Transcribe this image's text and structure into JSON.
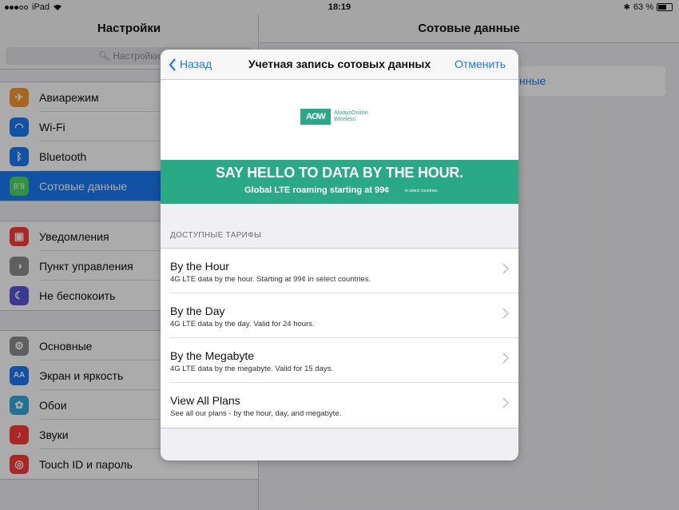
{
  "status_bar": {
    "carrier": "iPad",
    "time": "18:19",
    "battery": "63 %",
    "battery_level": 0.63
  },
  "left_pane": {
    "title": "Настройки",
    "search_placeholder": "Настройки",
    "groups": [
      [
        {
          "label": "Авиарежим",
          "icon": "airplane-icon",
          "color": "#f79a2c"
        },
        {
          "label": "Wi-Fi",
          "icon": "wifi-icon",
          "color": "#1a7bf5"
        },
        {
          "label": "Bluetooth",
          "icon": "bluetooth-icon",
          "color": "#1a7bf5"
        },
        {
          "label": "Сотовые данные",
          "icon": "antenna-icon",
          "color": "#4cd964",
          "selected": true
        }
      ],
      [
        {
          "label": "Уведомления",
          "icon": "notifications-icon",
          "color": "#fc3d39"
        },
        {
          "label": "Пункт управления",
          "icon": "control-center-icon",
          "color": "#8e8e93"
        },
        {
          "label": "Не беспокоить",
          "icon": "moon-icon",
          "color": "#5856d6"
        }
      ],
      [
        {
          "label": "Основные",
          "icon": "gear-icon",
          "color": "#8e8e93"
        },
        {
          "label": "Экран и яркость",
          "icon": "text-size-icon",
          "color": "#1a7bf5"
        },
        {
          "label": "Обои",
          "icon": "flower-icon",
          "color": "#34aadc"
        },
        {
          "label": "Звуки",
          "icon": "speaker-icon",
          "color": "#fc3d39"
        },
        {
          "label": "Touch ID и пароль",
          "icon": "fingerprint-icon",
          "color": "#fc3d39"
        }
      ]
    ]
  },
  "right_pane": {
    "title": "Сотовые данные",
    "cell_fragment": "нные"
  },
  "modal": {
    "back_label": "Назад",
    "title": "Учетная запись сотовых данных",
    "cancel_label": "Отменить",
    "logo_mark": "AOW",
    "logo_name_line1": "AlwaysOnline",
    "logo_name_line2": "Wireless",
    "banner_headline": "SAY HELLO TO DATA BY THE HOUR.",
    "banner_sub": "Global LTE roaming starting at 99¢",
    "banner_note": "in select countries.",
    "section_header": "ДОСТУПНЫЕ ТАРИФЫ",
    "plans": [
      {
        "title": "By the Hour",
        "desc": "4G LTE data by the hour. Starting at 99¢ in select countries."
      },
      {
        "title": "By the Day",
        "desc": "4G LTE data by the day. Valid for 24 hours."
      },
      {
        "title": "By the Megabyte",
        "desc": "4G LTE data by the megabyte. Valid for 15 days."
      },
      {
        "title": "View All Plans",
        "desc": "See all our plans - by the hour, day, and megabyte."
      }
    ]
  },
  "colors": {
    "accent": "#1a7bf5",
    "brand": "#29a985"
  }
}
